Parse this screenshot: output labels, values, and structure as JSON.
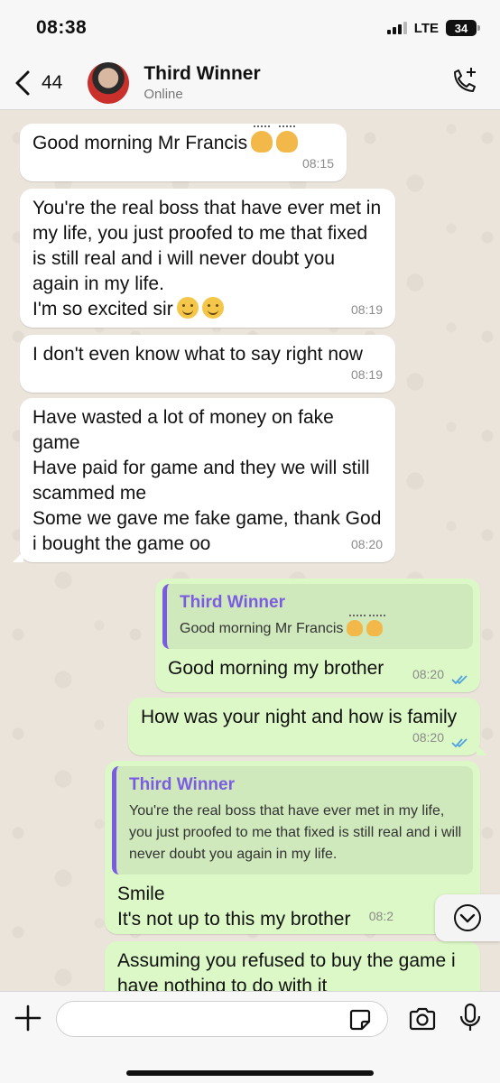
{
  "status_bar": {
    "time": "08:38",
    "network": "LTE",
    "battery": "34"
  },
  "header": {
    "back_count": "44",
    "contact_name": "Third Winner",
    "contact_status": "Online"
  },
  "messages": [
    {
      "direction": "in",
      "text": "Good morning Mr Francis",
      "emoji": [
        "person-bowing",
        "person-bowing"
      ],
      "time": "08:15"
    },
    {
      "direction": "in",
      "text": "You're the real boss that have ever met in my life, you just proofed to me that fixed is still real and i will never doubt you again in my life.",
      "text2": "I'm so excited sir",
      "emoji": [
        "smiling-face",
        "smiling-face"
      ],
      "time": "08:19"
    },
    {
      "direction": "in",
      "text": "I don't even know what to say right now",
      "time": "08:19"
    },
    {
      "direction": "in",
      "text": "Have wasted a lot of money on fake game\nHave paid for game and they we will still scammed me\nSome we gave me fake game, thank God i bought the game oo",
      "time": "08:20"
    },
    {
      "direction": "out",
      "quote_name": "Third Winner",
      "quote_text": "Good morning Mr Francis",
      "quote_emoji": [
        "person-bowing",
        "person-bowing"
      ],
      "text": "Good morning my brother",
      "time": "08:20",
      "status": "read"
    },
    {
      "direction": "out",
      "text": "How was your night and how is family",
      "time": "08:20",
      "status": "read"
    },
    {
      "direction": "out",
      "quote_name": "Third Winner",
      "quote_text": "You're the real boss that have ever met in my life, you just proofed to me that fixed is still real and i will never doubt you again in my life.",
      "text": "Smile\nIt's not up to this my brother",
      "time": "08:2"
    },
    {
      "direction": "out",
      "text": "Assuming you refused to buy the game i have nothing to do with it"
    }
  ],
  "input": {
    "placeholder": ""
  },
  "icons": {
    "back": "chevron-left-icon",
    "call": "phone-plus-icon",
    "plus": "plus-icon",
    "sticker": "sticker-icon",
    "camera": "camera-icon",
    "mic": "microphone-icon",
    "scroll": "chevron-down-icon",
    "read": "double-check-icon"
  },
  "colors": {
    "incoming_bubble": "#ffffff",
    "outgoing_bubble": "#dcf8c6",
    "quote_accent": "#7b5ce0",
    "read_ticks": "#4fa3e0"
  }
}
